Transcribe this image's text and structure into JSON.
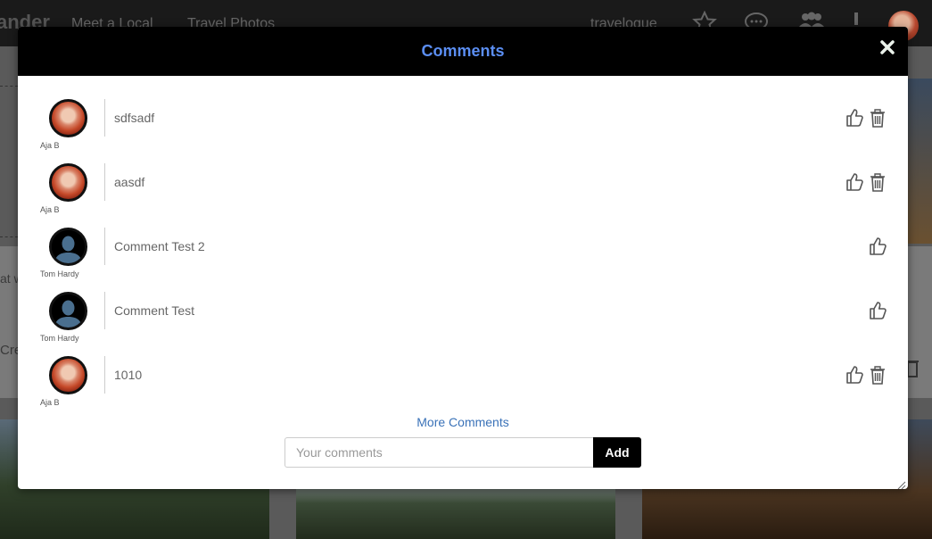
{
  "background": {
    "logo": "ander",
    "nav_links": [
      "Meet a Local",
      "Travel Photos"
    ],
    "username": "travelogue",
    "frag_left_1": "at w",
    "frag_left_2": "Cre"
  },
  "modal": {
    "title": "Comments",
    "close_icon": "close-icon",
    "comments": [
      {
        "author": "Aja B",
        "text": "sdfsadf",
        "avatar": "photo-avatar",
        "can_delete": true
      },
      {
        "author": "Aja B",
        "text": "aasdf",
        "avatar": "photo-avatar",
        "can_delete": true
      },
      {
        "author": "Tom Hardy",
        "text": "Comment Test 2",
        "avatar": "default-avatar",
        "can_delete": false
      },
      {
        "author": "Tom Hardy",
        "text": "Comment Test",
        "avatar": "default-avatar",
        "can_delete": false
      },
      {
        "author": "Aja B",
        "text": "1010",
        "avatar": "photo-avatar",
        "can_delete": true
      }
    ],
    "more_comments_label": "More Comments",
    "input_placeholder": "Your comments",
    "input_value": "",
    "add_label": "Add"
  },
  "colors": {
    "header_bg": "#000000",
    "title": "#5b8ef2",
    "link": "#3a72b8",
    "icon": "#555555"
  }
}
